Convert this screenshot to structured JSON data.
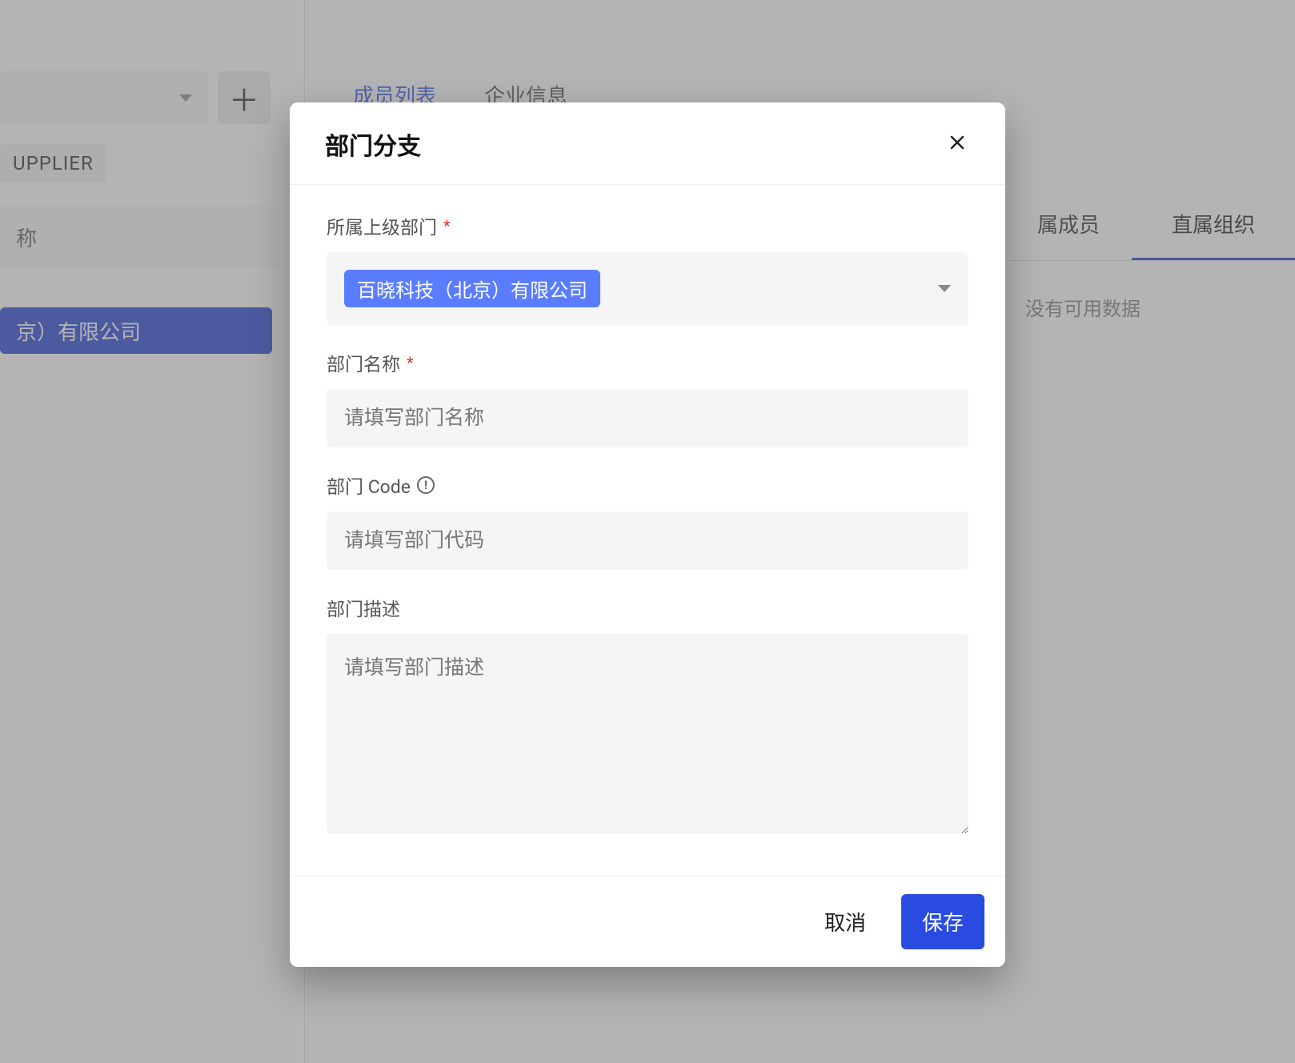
{
  "sidebar": {
    "supplier_chip": "UPPLIER",
    "search_placeholder": "称",
    "tree_selected": "京）有限公司"
  },
  "main": {
    "tabs": [
      {
        "label": "成员列表",
        "active": true
      },
      {
        "label": "企业信息",
        "active": false
      }
    ],
    "sub_tabs": {
      "left": "属成员",
      "right": "直属组织"
    },
    "no_data": "没有可用数据"
  },
  "modal": {
    "title": "部门分支",
    "fields": {
      "parent_dept": {
        "label": "所属上级部门",
        "selected": "百晓科技（北京）有限公司"
      },
      "dept_name": {
        "label": "部门名称",
        "placeholder": "请填写部门名称"
      },
      "dept_code": {
        "label": "部门 Code",
        "placeholder": "请填写部门代码"
      },
      "dept_desc": {
        "label": "部门描述",
        "placeholder": "请填写部门描述"
      }
    },
    "buttons": {
      "cancel": "取消",
      "save": "保存"
    }
  }
}
